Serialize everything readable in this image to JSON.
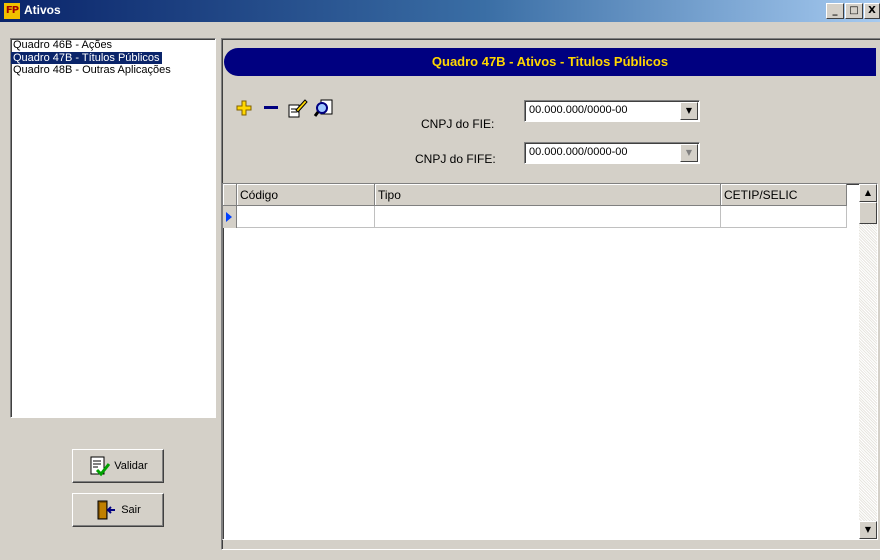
{
  "window": {
    "title": "Ativos",
    "app_icon": "FP",
    "controls": {
      "minimize": "_",
      "maximize": "□",
      "close": "X"
    }
  },
  "sidebar": {
    "items": [
      {
        "label": "Quadro 46B - Ações",
        "selected": false
      },
      {
        "label": "Quadro 47B - Títulos Públicos",
        "selected": true
      },
      {
        "label": "Quadro 48B - Outras Aplicações",
        "selected": false
      }
    ],
    "validate_label": "Validar",
    "exit_label": "Sair"
  },
  "main": {
    "banner_title": "Quadro 47B - Ativos -  Titulos Públicos",
    "toolbar_icons": [
      "plus-icon",
      "minus-icon",
      "edit-icon",
      "search-icon"
    ],
    "cnpj_fie": {
      "label": "CNPJ do FIE:",
      "value": "00.000.000/0000-00"
    },
    "cnpj_fife": {
      "label": "CNPJ do FIFE:",
      "value": "00.000.000/0000-00"
    },
    "grid": {
      "columns": [
        "Código",
        "Tipo",
        "CETIP/SELIC"
      ],
      "rows": [
        [
          "",
          "",
          ""
        ]
      ]
    }
  },
  "colors": {
    "title_bar": "#0a246a",
    "banner_bg": "#000080",
    "banner_text": "#ffd700",
    "selection": "#0a246a",
    "face": "#d4d0c8"
  }
}
